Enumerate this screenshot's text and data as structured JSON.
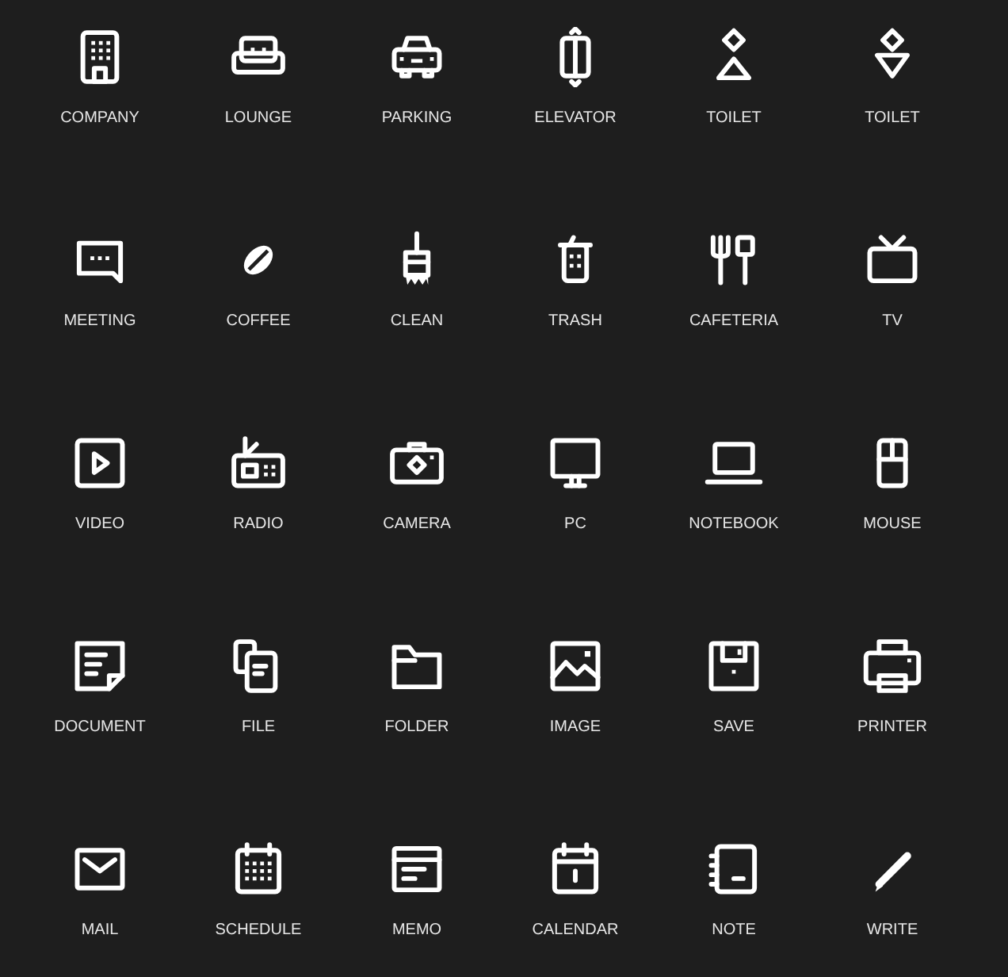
{
  "icons": [
    {
      "kind": "company",
      "label": "COMPANY"
    },
    {
      "kind": "lounge",
      "label": "LOUNGE"
    },
    {
      "kind": "parking",
      "label": "PARKING"
    },
    {
      "kind": "elevator",
      "label": "ELEVATOR"
    },
    {
      "kind": "toilet_male",
      "label": "TOILET"
    },
    {
      "kind": "toilet_female",
      "label": "TOILET"
    },
    {
      "kind": "meeting",
      "label": "MEETING"
    },
    {
      "kind": "coffee",
      "label": "COFFEE"
    },
    {
      "kind": "clean",
      "label": "CLEAN"
    },
    {
      "kind": "trash",
      "label": "TRASH"
    },
    {
      "kind": "cafeteria",
      "label": "CAFETERIA"
    },
    {
      "kind": "tv",
      "label": "TV"
    },
    {
      "kind": "video",
      "label": "VIDEO"
    },
    {
      "kind": "radio",
      "label": "RADIO"
    },
    {
      "kind": "camera",
      "label": "CAMERA"
    },
    {
      "kind": "pc",
      "label": "PC"
    },
    {
      "kind": "notebook",
      "label": "NOTEBOOK"
    },
    {
      "kind": "mouse",
      "label": "MOUSE"
    },
    {
      "kind": "document",
      "label": "DOCUMENT"
    },
    {
      "kind": "file",
      "label": "FILE"
    },
    {
      "kind": "folder",
      "label": "FOLDER"
    },
    {
      "kind": "image",
      "label": "IMAGE"
    },
    {
      "kind": "save",
      "label": "SAVE"
    },
    {
      "kind": "printer",
      "label": "PRINTER"
    },
    {
      "kind": "mail",
      "label": "MAIL"
    },
    {
      "kind": "schedule",
      "label": "SCHEDULE"
    },
    {
      "kind": "memo",
      "label": "MEMO"
    },
    {
      "kind": "calendar",
      "label": "CALENDAR"
    },
    {
      "kind": "note",
      "label": "NOTE"
    },
    {
      "kind": "write",
      "label": "WRITE"
    }
  ]
}
